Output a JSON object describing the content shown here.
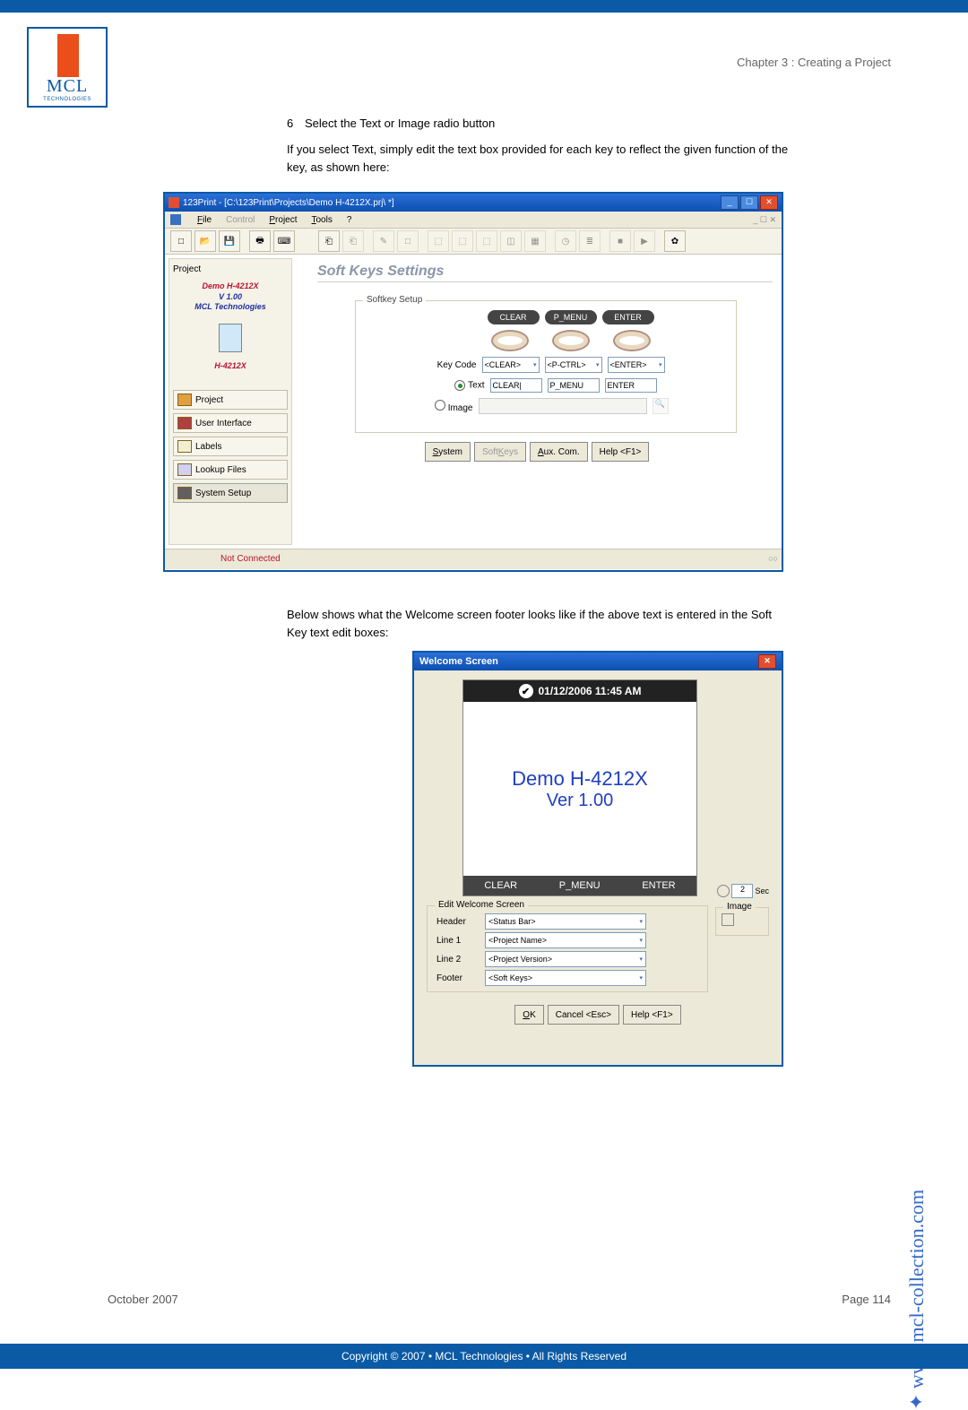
{
  "chapter": "Chapter 3 : Creating a Project",
  "logo": {
    "name": "MCL",
    "sub": "TECHNOLOGIES"
  },
  "step": {
    "num": "6",
    "text": "Select the Text or Image radio button"
  },
  "para1": "If you select Text, simply edit the text box provided for each key to reflect the given function of the key, as shown here:",
  "para2": "Below shows what the Welcome screen footer looks like if the above text is entered in the Soft Key text edit boxes:",
  "app": {
    "title": "123Print - [C:\\123Print\\Projects\\Demo H-4212X.prj\\ *]",
    "menu": [
      "File",
      "Control",
      "Project",
      "Tools",
      "?"
    ],
    "childctrl": "_ ☐ ✕",
    "winbtns": [
      "_",
      "☐",
      "✕"
    ],
    "project_label": "Project",
    "project": {
      "name": "Demo H-4212X",
      "version": "V 1.00",
      "company": "MCL Technologies",
      "model": "H-4212X"
    },
    "sidebar": [
      "Project",
      "User Interface",
      "Labels",
      "Lookup Files",
      "System Setup"
    ],
    "status": "Not Connected",
    "lights": "○○",
    "settings_title": "Soft Keys Settings",
    "softkey_legend": "Softkey Setup",
    "pills": [
      "CLEAR",
      "P_MENU",
      "ENTER"
    ],
    "keycode_label": "Key Code",
    "keycodes": [
      "<CLEAR>",
      "<P-CTRL>",
      "<ENTER>"
    ],
    "text_label": "Text",
    "image_label": "Image",
    "text_vals": [
      "CLEAR|",
      "P_MENU",
      "ENTER"
    ],
    "buttons": [
      "System",
      "Soft Keys",
      "Aux. Com.",
      "Help <F1>"
    ]
  },
  "welcome": {
    "title": "Welcome Screen",
    "status": "01/12/2006 11:45 AM",
    "name": "Demo H-4212X",
    "ver": "Ver 1.00",
    "footer": [
      "CLEAR",
      "P_MENU",
      "ENTER"
    ],
    "timer": "2",
    "timer_unit": "Sec",
    "ews_legend": "Edit Welcome Screen",
    "img_legend": "Image",
    "rows": [
      {
        "label": "Header",
        "value": "<Status Bar>"
      },
      {
        "label": "Line 1",
        "value": "<Project Name>"
      },
      {
        "label": "Line 2",
        "value": "<Project Version>"
      },
      {
        "label": "Footer",
        "value": "<Soft Keys>"
      }
    ],
    "buttons": [
      "OK",
      "Cancel <Esc>",
      "Help <F1>"
    ]
  },
  "site": "www.mcl-collection.com",
  "footer": {
    "date": "October 2007",
    "page": "Page 114"
  },
  "copyright": "Copyright © 2007 • MCL Technologies • All Rights Reserved"
}
